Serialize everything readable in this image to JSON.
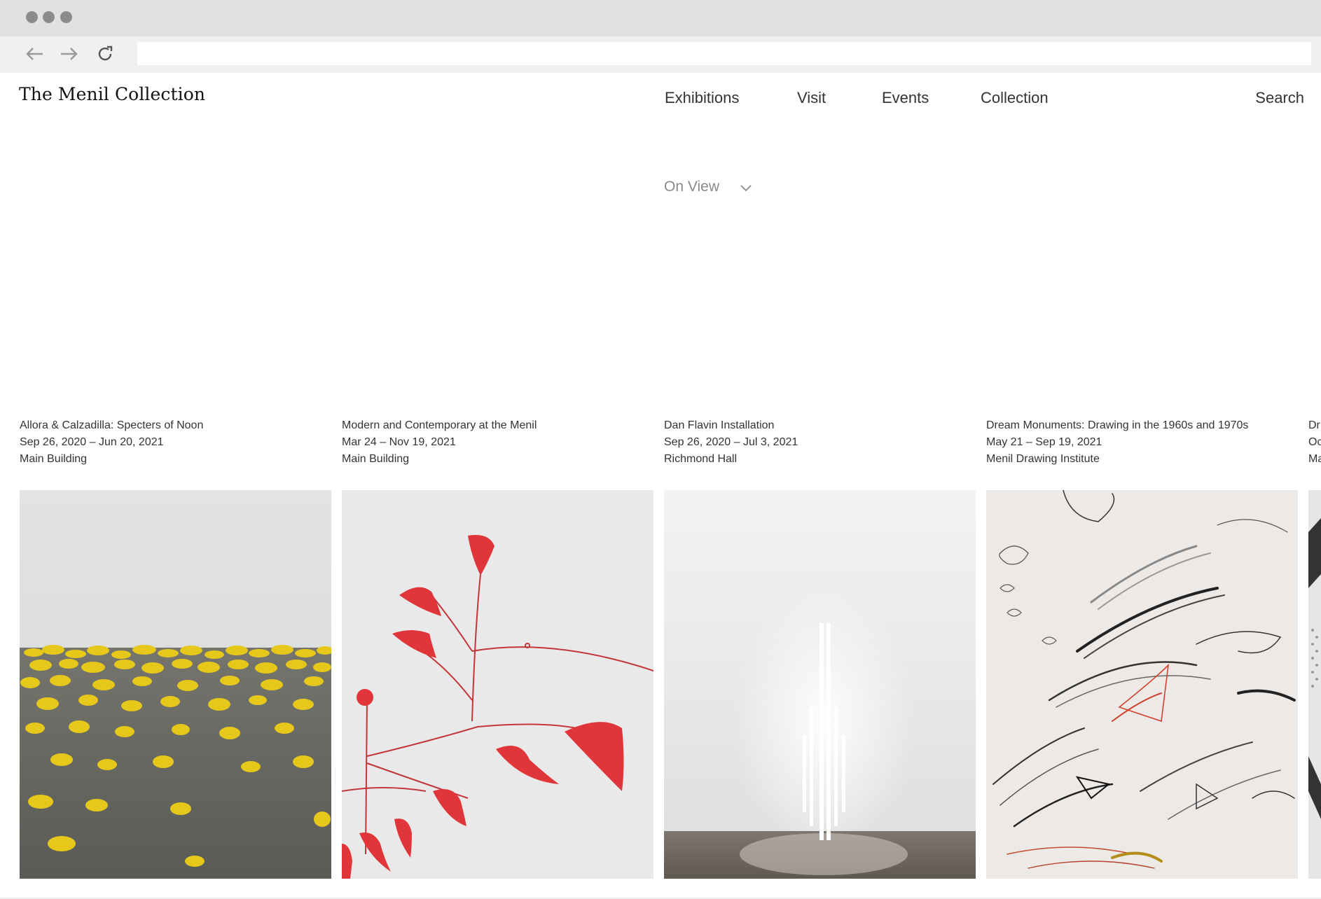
{
  "site": {
    "logo": "The Menil Collection",
    "nav": [
      "Exhibitions",
      "Visit",
      "Events",
      "Collection"
    ],
    "search": "Search"
  },
  "filter": {
    "label": "On View",
    "icon": "chevron-down-icon"
  },
  "exhibitions": [
    {
      "title": "Allora & Calzadilla: Specters of Noon",
      "dates": "Sep 26, 2020 – Jun 20, 2021",
      "location": "Main Building"
    },
    {
      "title": "Modern and Contemporary at the Menil",
      "dates": "Mar 24 – Nov 19, 2021",
      "location": "Main Building"
    },
    {
      "title": "Dan Flavin Installation",
      "dates": "Sep 26, 2020 – Jul 3, 2021",
      "location": "Richmond Hall"
    },
    {
      "title": "Dream Monuments: Drawing in the 1960s and 1970s",
      "dates": "May 21 – Sep 19, 2021",
      "location": "Menil Drawing Institute"
    },
    {
      "title": "Dr",
      "dates": "Oc",
      "location": "Ma"
    }
  ],
  "colors": {
    "accent_yellow": "#e8cc1c",
    "mobile_red": "#e0363a",
    "chrome": "#e1e1e1"
  }
}
